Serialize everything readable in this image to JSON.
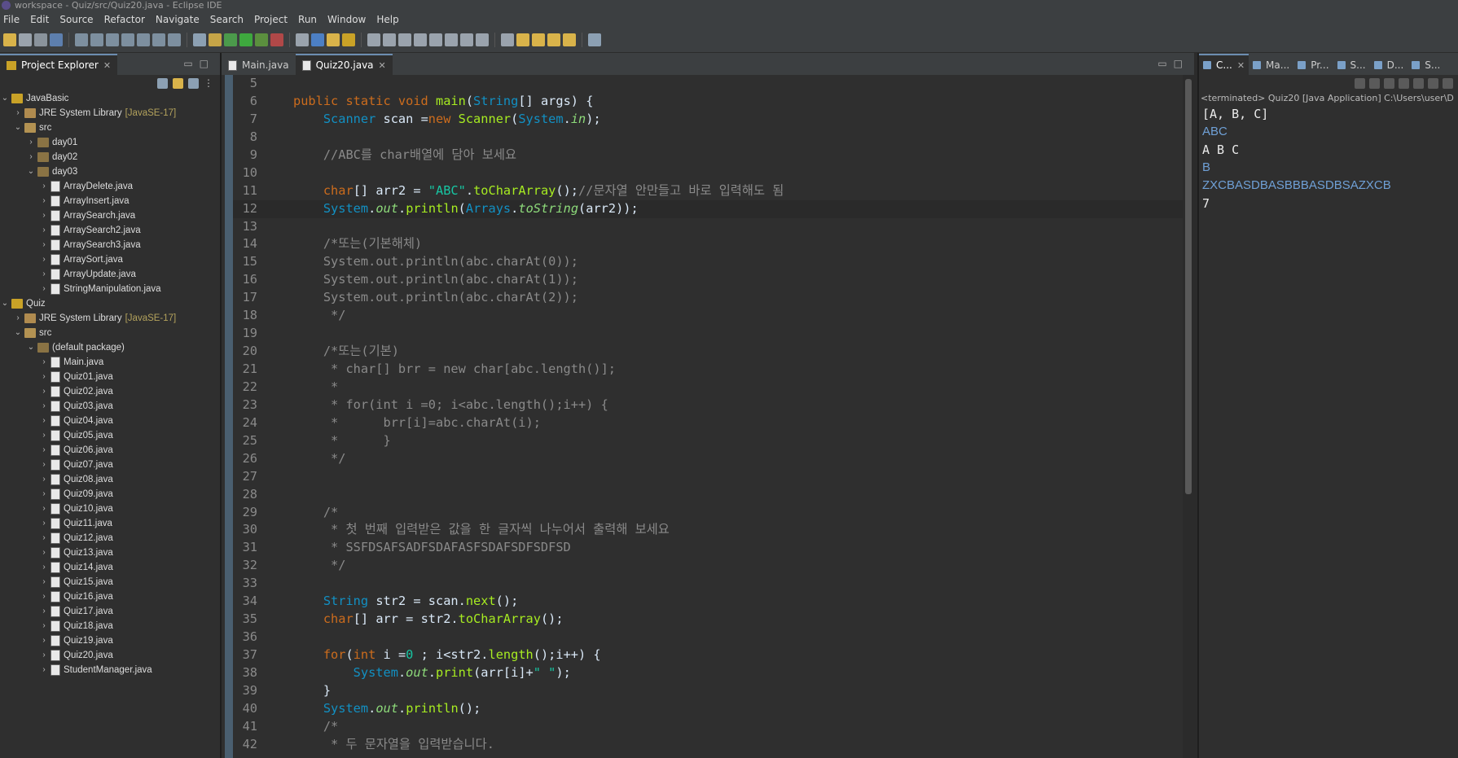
{
  "window": {
    "title": "workspace - Quiz/src/Quiz20.java - Eclipse IDE"
  },
  "menu": [
    "File",
    "Edit",
    "Source",
    "Refactor",
    "Navigate",
    "Search",
    "Project",
    "Run",
    "Window",
    "Help"
  ],
  "explorer": {
    "tab_label": "Project Explorer",
    "tree": [
      {
        "depth": 0,
        "chev": "v",
        "icon": "proj",
        "label": "JavaBasic"
      },
      {
        "depth": 1,
        "chev": ">",
        "icon": "lib",
        "label": "JRE System Library",
        "tag": "[JavaSE-17]"
      },
      {
        "depth": 1,
        "chev": "v",
        "icon": "src",
        "label": "src"
      },
      {
        "depth": 2,
        "chev": ">",
        "icon": "pkg",
        "label": "day01"
      },
      {
        "depth": 2,
        "chev": ">",
        "icon": "pkg",
        "label": "day02"
      },
      {
        "depth": 2,
        "chev": "v",
        "icon": "pkg",
        "label": "day03"
      },
      {
        "depth": 3,
        "chev": ">",
        "icon": "java",
        "label": "ArrayDelete.java"
      },
      {
        "depth": 3,
        "chev": ">",
        "icon": "java",
        "label": "ArrayInsert.java"
      },
      {
        "depth": 3,
        "chev": ">",
        "icon": "java",
        "label": "ArraySearch.java"
      },
      {
        "depth": 3,
        "chev": ">",
        "icon": "java",
        "label": "ArraySearch2.java"
      },
      {
        "depth": 3,
        "chev": ">",
        "icon": "java",
        "label": "ArraySearch3.java"
      },
      {
        "depth": 3,
        "chev": ">",
        "icon": "java",
        "label": "ArraySort.java"
      },
      {
        "depth": 3,
        "chev": ">",
        "icon": "java",
        "label": "ArrayUpdate.java"
      },
      {
        "depth": 3,
        "chev": ">",
        "icon": "java",
        "label": "StringManipulation.java"
      },
      {
        "depth": 0,
        "chev": "v",
        "icon": "proj",
        "label": "Quiz"
      },
      {
        "depth": 1,
        "chev": ">",
        "icon": "lib",
        "label": "JRE System Library",
        "tag": "[JavaSE-17]"
      },
      {
        "depth": 1,
        "chev": "v",
        "icon": "src",
        "label": "src"
      },
      {
        "depth": 2,
        "chev": "v",
        "icon": "pkg",
        "label": "(default package)"
      },
      {
        "depth": 3,
        "chev": ">",
        "icon": "java",
        "label": "Main.java"
      },
      {
        "depth": 3,
        "chev": ">",
        "icon": "java",
        "label": "Quiz01.java"
      },
      {
        "depth": 3,
        "chev": ">",
        "icon": "java",
        "label": "Quiz02.java"
      },
      {
        "depth": 3,
        "chev": ">",
        "icon": "java",
        "label": "Quiz03.java"
      },
      {
        "depth": 3,
        "chev": ">",
        "icon": "java",
        "label": "Quiz04.java"
      },
      {
        "depth": 3,
        "chev": ">",
        "icon": "java",
        "label": "Quiz05.java"
      },
      {
        "depth": 3,
        "chev": ">",
        "icon": "java",
        "label": "Quiz06.java"
      },
      {
        "depth": 3,
        "chev": ">",
        "icon": "java",
        "label": "Quiz07.java"
      },
      {
        "depth": 3,
        "chev": ">",
        "icon": "java",
        "label": "Quiz08.java"
      },
      {
        "depth": 3,
        "chev": ">",
        "icon": "java",
        "label": "Quiz09.java"
      },
      {
        "depth": 3,
        "chev": ">",
        "icon": "java",
        "label": "Quiz10.java"
      },
      {
        "depth": 3,
        "chev": ">",
        "icon": "java",
        "label": "Quiz11.java"
      },
      {
        "depth": 3,
        "chev": ">",
        "icon": "java",
        "label": "Quiz12.java"
      },
      {
        "depth": 3,
        "chev": ">",
        "icon": "java",
        "label": "Quiz13.java"
      },
      {
        "depth": 3,
        "chev": ">",
        "icon": "java",
        "label": "Quiz14.java"
      },
      {
        "depth": 3,
        "chev": ">",
        "icon": "java",
        "label": "Quiz15.java"
      },
      {
        "depth": 3,
        "chev": ">",
        "icon": "java",
        "label": "Quiz16.java"
      },
      {
        "depth": 3,
        "chev": ">",
        "icon": "java",
        "label": "Quiz17.java"
      },
      {
        "depth": 3,
        "chev": ">",
        "icon": "java",
        "label": "Quiz18.java"
      },
      {
        "depth": 3,
        "chev": ">",
        "icon": "java",
        "label": "Quiz19.java"
      },
      {
        "depth": 3,
        "chev": ">",
        "icon": "java",
        "label": "Quiz20.java"
      },
      {
        "depth": 3,
        "chev": ">",
        "icon": "java",
        "label": "StudentManager.java"
      }
    ]
  },
  "editor": {
    "tabs": [
      {
        "label": "Main.java",
        "active": false
      },
      {
        "label": "Quiz20.java",
        "active": true
      }
    ],
    "current_line": 12,
    "lines": [
      {
        "n": "5",
        "tokens": []
      },
      {
        "n": "6",
        "tokens": [
          [
            "kw",
            "public static void "
          ],
          [
            "fn",
            "main"
          ],
          [
            "",
            "("
          ],
          [
            "ty",
            "String"
          ],
          [
            "",
            "[] args) {"
          ]
        ]
      },
      {
        "n": "7",
        "tokens": [
          [
            "ty",
            "    Scanner "
          ],
          [
            "",
            "scan "
          ],
          [
            "",
            "="
          ],
          [
            "kw",
            "new "
          ],
          [
            "fn",
            "Scanner"
          ],
          [
            "",
            "("
          ],
          [
            "ty",
            "System"
          ],
          [
            "",
            "."
          ],
          [
            "field",
            "in"
          ],
          [
            "",
            ");"
          ]
        ]
      },
      {
        "n": "8",
        "tokens": []
      },
      {
        "n": "9",
        "tokens": [
          [
            "cm",
            "    //ABC를 char배열에 담아 보세요"
          ]
        ]
      },
      {
        "n": "10",
        "tokens": []
      },
      {
        "n": "11",
        "tokens": [
          [
            "kw",
            "    char"
          ],
          [
            "",
            "[] arr2 = "
          ],
          [
            "st",
            "\"ABC\""
          ],
          [
            "",
            "."
          ],
          [
            "fn",
            "toCharArray"
          ],
          [
            "",
            "();"
          ],
          [
            "cm",
            "//문자열 안만들고 바로 입력해도 됨"
          ]
        ]
      },
      {
        "n": "12",
        "tokens": [
          [
            "ty",
            "    System"
          ],
          [
            "",
            "."
          ],
          [
            "field",
            "out"
          ],
          [
            "",
            "."
          ],
          [
            "fn",
            "println"
          ],
          [
            "",
            "("
          ],
          [
            "ty",
            "Arrays"
          ],
          [
            "",
            "."
          ],
          [
            "field",
            "toString"
          ],
          [
            "",
            "(arr2));"
          ]
        ]
      },
      {
        "n": "13",
        "tokens": []
      },
      {
        "n": "14",
        "tokens": [
          [
            "cm",
            "    /*또는(기본해체)"
          ]
        ]
      },
      {
        "n": "15",
        "tokens": [
          [
            "cm",
            "    System.out.println(abc.charAt(0));"
          ]
        ]
      },
      {
        "n": "16",
        "tokens": [
          [
            "cm",
            "    System.out.println(abc.charAt(1));"
          ]
        ]
      },
      {
        "n": "17",
        "tokens": [
          [
            "cm",
            "    System.out.println(abc.charAt(2));"
          ]
        ]
      },
      {
        "n": "18",
        "tokens": [
          [
            "cm",
            "     */"
          ]
        ]
      },
      {
        "n": "19",
        "tokens": []
      },
      {
        "n": "20",
        "tokens": [
          [
            "cm",
            "    /*또는(기본)"
          ]
        ]
      },
      {
        "n": "21",
        "tokens": [
          [
            "cm",
            "     * char[] brr = new char[abc.length()];"
          ]
        ]
      },
      {
        "n": "22",
        "tokens": [
          [
            "cm",
            "     *"
          ]
        ]
      },
      {
        "n": "23",
        "tokens": [
          [
            "cm",
            "     * for(int i =0; i<abc.length();i++) {"
          ]
        ]
      },
      {
        "n": "24",
        "tokens": [
          [
            "cm",
            "     *      brr[i]=abc.charAt(i);"
          ]
        ]
      },
      {
        "n": "25",
        "tokens": [
          [
            "cm",
            "     *      }"
          ]
        ]
      },
      {
        "n": "26",
        "tokens": [
          [
            "cm",
            "     */"
          ]
        ]
      },
      {
        "n": "27",
        "tokens": []
      },
      {
        "n": "28",
        "tokens": []
      },
      {
        "n": "29",
        "tokens": [
          [
            "cm",
            "    /*"
          ]
        ]
      },
      {
        "n": "30",
        "tokens": [
          [
            "cm",
            "     * 첫 번째 입력받은 값을 한 글자씩 나누어서 출력해 보세요"
          ]
        ]
      },
      {
        "n": "31",
        "tokens": [
          [
            "cm",
            "     * SSFDSAFSADFSDAFASFSDAFSDFSDFSD"
          ]
        ]
      },
      {
        "n": "32",
        "tokens": [
          [
            "cm",
            "     */"
          ]
        ]
      },
      {
        "n": "33",
        "tokens": []
      },
      {
        "n": "34",
        "tokens": [
          [
            "ty",
            "    String "
          ],
          [
            "",
            "str2 = scan."
          ],
          [
            "fn",
            "next"
          ],
          [
            "",
            "();"
          ]
        ]
      },
      {
        "n": "35",
        "tokens": [
          [
            "kw",
            "    char"
          ],
          [
            "",
            "[] arr = str2."
          ],
          [
            "fn",
            "toCharArray"
          ],
          [
            "",
            "();"
          ]
        ]
      },
      {
        "n": "36",
        "tokens": []
      },
      {
        "n": "37",
        "tokens": [
          [
            "kw",
            "    for"
          ],
          [
            "",
            "("
          ],
          [
            "kw",
            "int "
          ],
          [
            "",
            "i ="
          ],
          [
            "st",
            "0 "
          ],
          [
            "",
            "; i<str2."
          ],
          [
            "fn",
            "length"
          ],
          [
            "",
            "();i++) {"
          ]
        ]
      },
      {
        "n": "38",
        "tokens": [
          [
            "ty",
            "        System"
          ],
          [
            "",
            "."
          ],
          [
            "field",
            "out"
          ],
          [
            "",
            "."
          ],
          [
            "fn",
            "print"
          ],
          [
            "",
            "(arr[i]+"
          ],
          [
            "st",
            "\" \""
          ],
          [
            "",
            ");"
          ]
        ]
      },
      {
        "n": "39",
        "tokens": [
          [
            "",
            "    }"
          ]
        ]
      },
      {
        "n": "40",
        "tokens": [
          [
            "ty",
            "    System"
          ],
          [
            "",
            "."
          ],
          [
            "field",
            "out"
          ],
          [
            "",
            "."
          ],
          [
            "fn",
            "println"
          ],
          [
            "",
            "();"
          ]
        ]
      },
      {
        "n": "41",
        "tokens": [
          [
            "cm",
            "    /*"
          ]
        ]
      },
      {
        "n": "42",
        "tokens": [
          [
            "cm",
            "     * 두 문자열을 입력받습니다."
          ]
        ]
      }
    ]
  },
  "console": {
    "tabs": [
      "C...",
      "Ma...",
      "Pr...",
      "S...",
      "D...",
      "S..."
    ],
    "status": "<terminated> Quiz20 [Java Application] C:\\Users\\user\\D",
    "output": [
      {
        "kind": "sys",
        "text": "[A, B, C]"
      },
      {
        "kind": "in",
        "text": "ABC"
      },
      {
        "kind": "sys",
        "text": "A B C"
      },
      {
        "kind": "in",
        "text": "B"
      },
      {
        "kind": "in",
        "text": "ZXCBASDBASBBBASDBSAZXCB"
      },
      {
        "kind": "sys",
        "text": "7"
      }
    ]
  },
  "colors": {
    "keyword": "#cc6c1d",
    "type": "#1290c3",
    "comment": "#8a8a8a",
    "string": "#17c6a3",
    "method": "#a7ec21",
    "console_input": "#6fa0d6"
  }
}
